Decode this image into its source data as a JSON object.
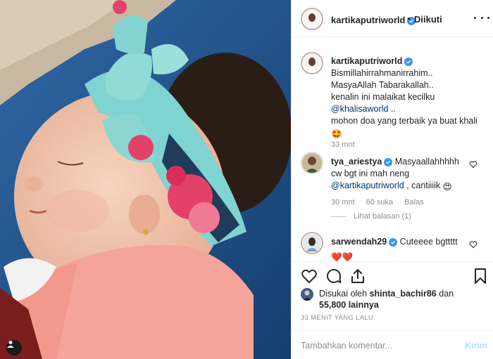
{
  "photo": {
    "alt_icons": {
      "user_tag": "person-icon"
    }
  },
  "header": {
    "username": "kartikaputriworld",
    "separator": "•",
    "follow_status": "Diikuti",
    "icons": {
      "verified": "verified-badge-icon",
      "more": "more-options-icon"
    }
  },
  "caption": {
    "username": "kartikaputriworld",
    "lines": [
      "Bismillahirrahmanirrahim..",
      "MasyaAllah Tabarakallah..",
      "kenalin ini malaikat kecilku"
    ],
    "mention": "@khalisaworld",
    "mention_suffix": " ..",
    "line_last": "mohon doa yang terbaik ya buat khali",
    "emoji": "🤩",
    "time": "33 mnt"
  },
  "comments": [
    {
      "username": "tya_ariestya",
      "text_1": "Masyaallahhhhh",
      "text_2": "cw bgt ini mah neng",
      "mention": "@kartikaputriworld",
      "text_3": ", cantiiiik",
      "emoji": "😍",
      "time": "30 mnt",
      "likes": "60 suka",
      "reply": "Balas",
      "view_replies": "Lihat balasan (1)"
    },
    {
      "username": "sarwendah29",
      "text": "Cuteeee bgttttt",
      "hearts": "❤️❤️"
    }
  ],
  "actions": {
    "icons": [
      "heart-icon",
      "comment-icon",
      "share-icon",
      "bookmark-icon"
    ]
  },
  "likes": {
    "prefix": "Disukai oleh",
    "user": "shintа_bachir86",
    "conj": "dan",
    "count": "55,800 lainnya"
  },
  "timestamp": "33 MENIT YANG LALU",
  "add_comment": {
    "placeholder": "Tambahkan komentar...",
    "post_label": "Kirim"
  },
  "colors": {
    "accent": "#3897f0",
    "post_disabled": "#b2dffc",
    "text": "#262626",
    "muted": "#8e8e8e",
    "mention": "#00376b",
    "heart": "#ed4956"
  }
}
